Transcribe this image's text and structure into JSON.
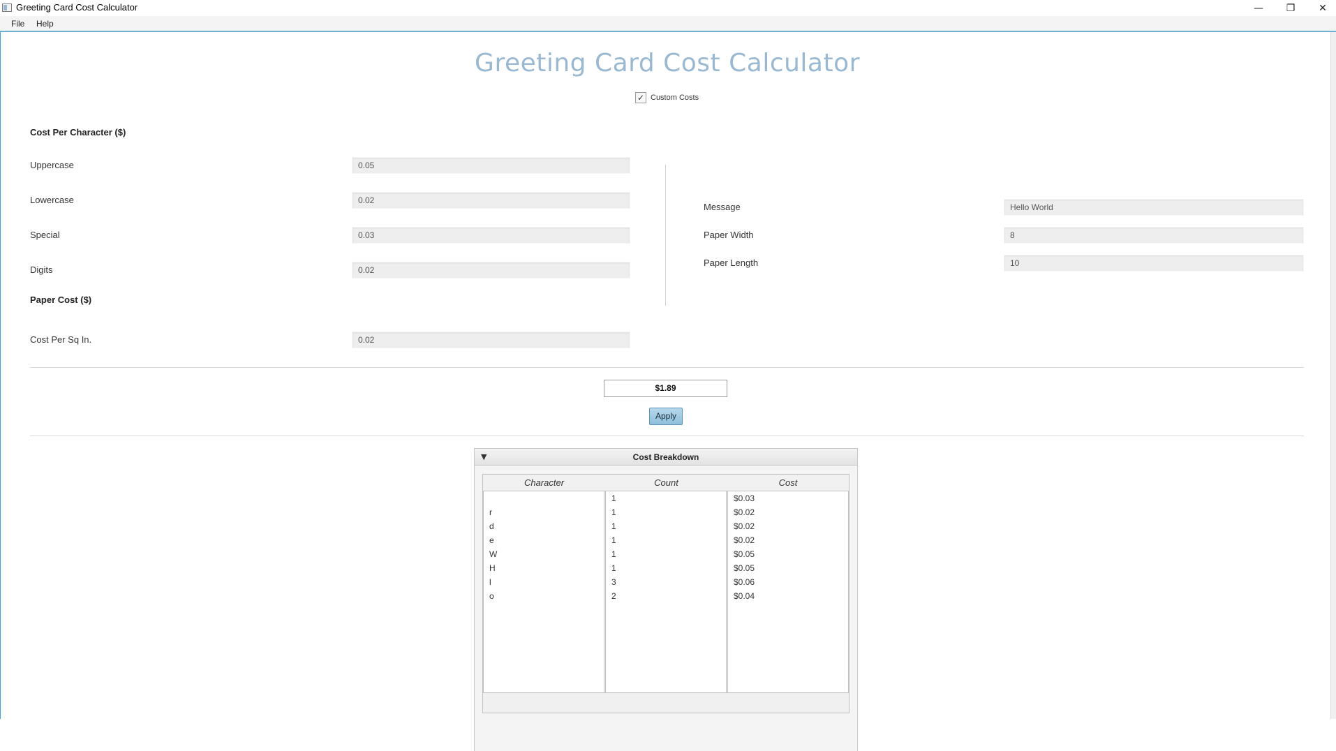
{
  "window": {
    "title": "Greeting Card Cost Calculator"
  },
  "menu": {
    "file": "File",
    "help": "Help"
  },
  "app": {
    "title": "Greeting Card Cost Calculator"
  },
  "custom_costs": {
    "label": "Custom Costs",
    "checked": true
  },
  "cost_per_character": {
    "heading": "Cost Per Character ($)",
    "uppercase": {
      "label": "Uppercase",
      "value": "0.05"
    },
    "lowercase": {
      "label": "Lowercase",
      "value": "0.02"
    },
    "special": {
      "label": "Special",
      "value": "0.03"
    },
    "digits": {
      "label": "Digits",
      "value": "0.02"
    }
  },
  "paper_cost": {
    "heading": "Paper Cost ($)",
    "per_sq_in": {
      "label": "Cost Per Sq In.",
      "value": "0.02"
    }
  },
  "card": {
    "message": {
      "label": "Message",
      "value": "Hello World"
    },
    "paper_width": {
      "label": "Paper Width",
      "value": "8"
    },
    "paper_length": {
      "label": "Paper Length",
      "value": "10"
    }
  },
  "total": "$1.89",
  "apply_label": "Apply",
  "breakdown": {
    "title": "Cost Breakdown",
    "columns": [
      "Character",
      "Count",
      "Cost"
    ],
    "rows": [
      {
        "character": " ",
        "count": "1",
        "cost": "$0.03"
      },
      {
        "character": "r",
        "count": "1",
        "cost": "$0.02"
      },
      {
        "character": "d",
        "count": "1",
        "cost": "$0.02"
      },
      {
        "character": "e",
        "count": "1",
        "cost": "$0.02"
      },
      {
        "character": "W",
        "count": "1",
        "cost": "$0.05"
      },
      {
        "character": "H",
        "count": "1",
        "cost": "$0.05"
      },
      {
        "character": "l",
        "count": "3",
        "cost": "$0.06"
      },
      {
        "character": "o",
        "count": "2",
        "cost": "$0.04"
      }
    ]
  }
}
